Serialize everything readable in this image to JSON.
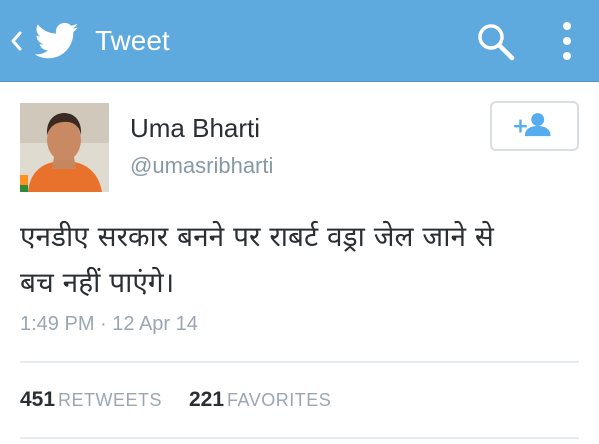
{
  "header": {
    "title": "Tweet",
    "back_icon": "chevron-left-icon",
    "logo_icon": "twitter-bird-icon",
    "search_icon": "search-icon",
    "overflow_icon": "more-vertical-icon",
    "bar_color": "#5ea9dd"
  },
  "tweet": {
    "author_name": "Uma Bharti",
    "author_handle": "@umasribharti",
    "avatar_icon": "profile-photo",
    "follow_icon": "follow-add-user-icon",
    "text_line1": "एनडीए सरकार बनने पर राबर्ट वड्रा जेल जाने से",
    "text_line2": "बच नहीं पाएंगे।",
    "timestamp": "1:49 PM · 12 Apr 14",
    "retweets_count": "451",
    "retweets_label": "RETWEETS",
    "favorites_count": "221",
    "favorites_label": "FAVORITES",
    "accent_color": "#55acee"
  }
}
